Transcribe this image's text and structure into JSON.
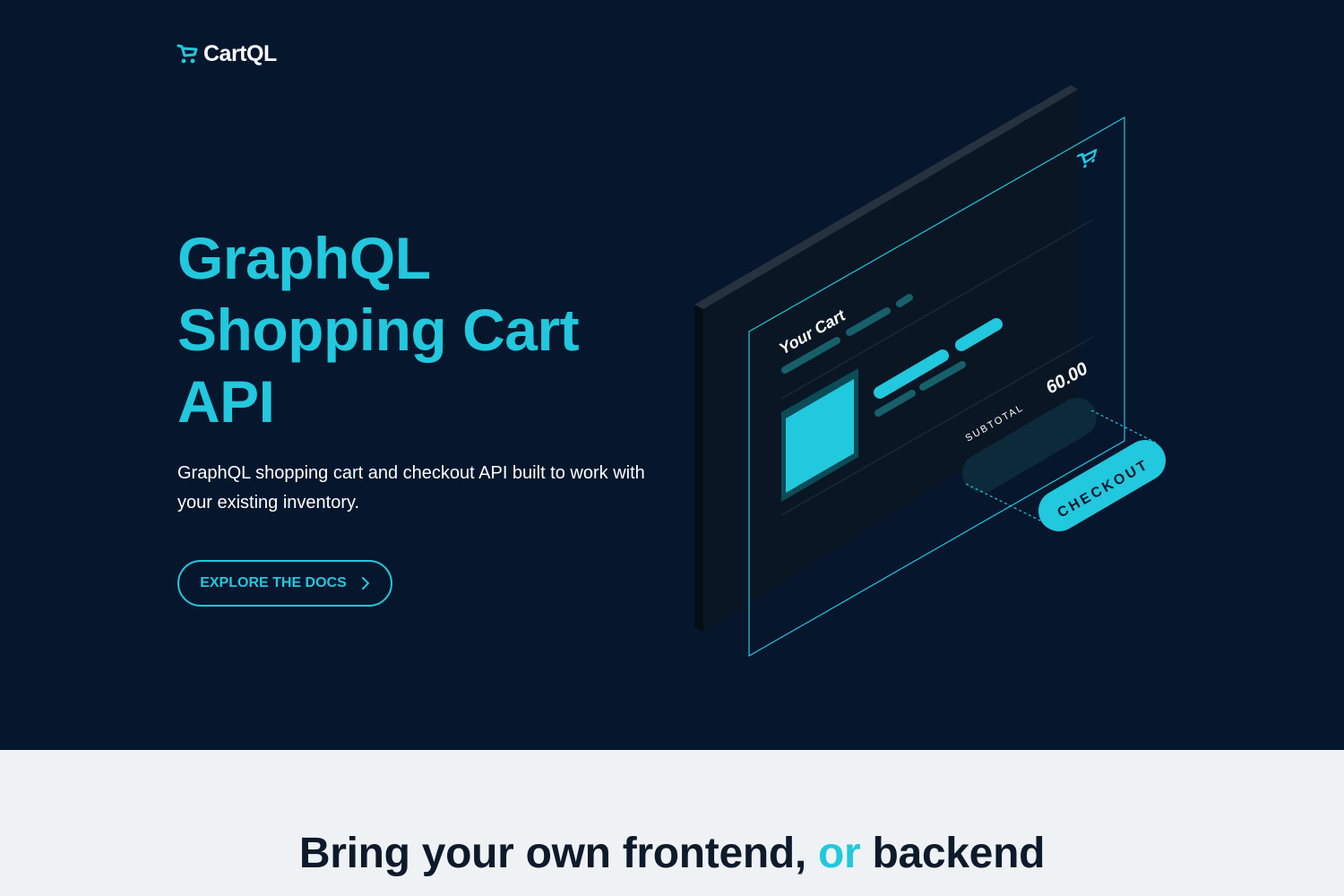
{
  "brand": {
    "name": "CartQL",
    "accent_color": "#22c8dd",
    "background_color": "#05162d",
    "icon": "cart-icon"
  },
  "hero": {
    "headline": [
      "GraphQL",
      "Shopping Cart",
      "API"
    ],
    "subtitle": "GraphQL shopping cart and checkout API built to work with your existing inventory.",
    "cta": {
      "label": "EXPLORE THE DOCS",
      "icon": "chevron-right-icon"
    }
  },
  "illustration": {
    "cart_title": "Your Cart",
    "subtotal_label": "SUBTOTAL",
    "subtotal_value": "60.00",
    "checkout_label": "CHECKOUT"
  },
  "section": {
    "title_part1": "Bring your own frontend,",
    "title_accent": "or",
    "title_part2": "backend",
    "light_background": "#eff2f5"
  }
}
